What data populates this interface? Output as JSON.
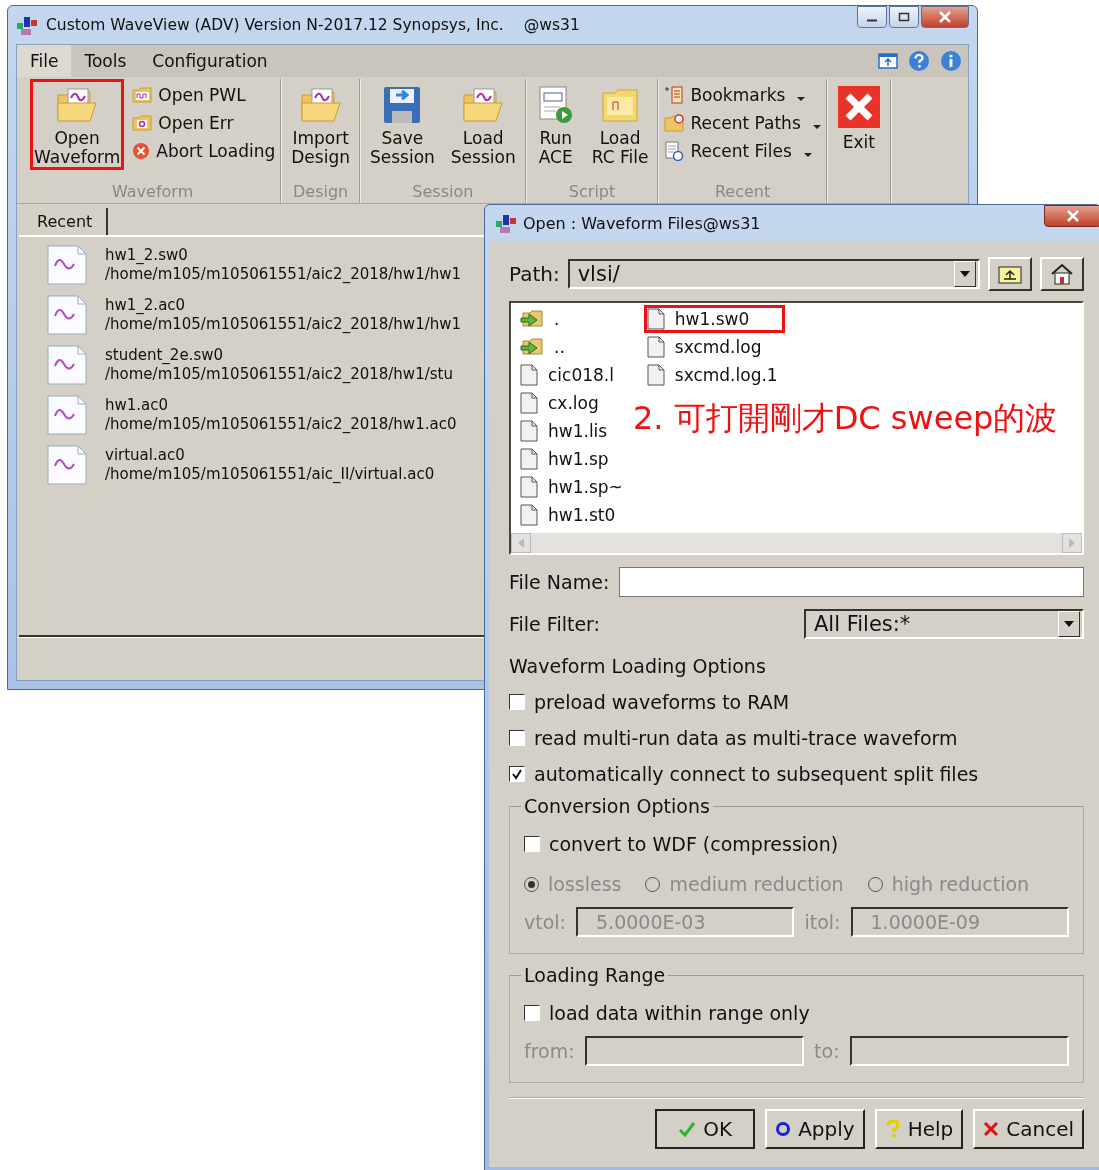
{
  "main_window": {
    "title": "Custom WaveView (ADV) Version N-2017.12 Synopsys, Inc.",
    "host": "@ws31"
  },
  "menu": [
    {
      "label": "File",
      "selected": true
    },
    {
      "label": "Tools",
      "selected": false
    },
    {
      "label": "Configuration",
      "selected": false
    }
  ],
  "ribbon": [
    {
      "label": "Waveform",
      "items": [
        {
          "kind": "large",
          "label": "Open\nWaveform",
          "highlighted": true
        },
        {
          "kind": "small",
          "label": "Open PWL"
        },
        {
          "kind": "small",
          "label": "Open Err"
        },
        {
          "kind": "small",
          "label": "Abort Loading"
        }
      ]
    },
    {
      "label": "Design",
      "items": [
        {
          "kind": "large",
          "label": "Import\nDesign"
        }
      ]
    },
    {
      "label": "Session",
      "items": [
        {
          "kind": "large",
          "label": "Save\nSession"
        },
        {
          "kind": "large",
          "label": "Load\nSession"
        }
      ]
    },
    {
      "label": "Script",
      "items": [
        {
          "kind": "large",
          "label": "Run\nACE"
        },
        {
          "kind": "large",
          "label": "Load\nRC File"
        }
      ]
    },
    {
      "label": "Recent",
      "items": [
        {
          "kind": "dropdown",
          "label": "Bookmarks"
        },
        {
          "kind": "dropdown",
          "label": "Recent Paths"
        },
        {
          "kind": "dropdown",
          "label": "Recent Files"
        }
      ]
    },
    {
      "items": [
        {
          "kind": "large",
          "label": "Exit"
        }
      ]
    }
  ],
  "tabs": [
    {
      "label": "Recent",
      "selected": true
    }
  ],
  "recent_files": [
    {
      "name": "hw1_2.sw0",
      "path": "/home/m105/m105061551/aic2_2018/hw1/hw1"
    },
    {
      "name": "hw1_2.ac0",
      "path": "/home/m105/m105061551/aic2_2018/hw1/hw1"
    },
    {
      "name": "student_2e.sw0",
      "path": "/home/m105/m105061551/aic2_2018/hw1/stu"
    },
    {
      "name": "hw1.ac0",
      "path": "/home/m105/m105061551/aic2_2018/hw1.ac0"
    },
    {
      "name": "virtual.ac0",
      "path": "/home/m105/m105061551/aic_II/virtual.ac0"
    }
  ],
  "dialog": {
    "title": "Open : Waveform Files@ws31",
    "path": {
      "label": "Path:",
      "value": "vlsi/"
    },
    "files": [
      {
        "name": ".",
        "kind": "folder",
        "highlighted": false
      },
      {
        "name": "..",
        "kind": "folder",
        "highlighted": false
      },
      {
        "name": "cic018.l",
        "kind": "file",
        "highlighted": false
      },
      {
        "name": "cx.log",
        "kind": "file",
        "highlighted": false
      },
      {
        "name": "hw1.lis",
        "kind": "file",
        "highlighted": false
      },
      {
        "name": "hw1.sp",
        "kind": "file",
        "highlighted": false
      },
      {
        "name": "hw1.sp~",
        "kind": "file",
        "highlighted": false
      },
      {
        "name": "hw1.st0",
        "kind": "file",
        "highlighted": false
      },
      {
        "name": "hw1.sw0",
        "kind": "file",
        "highlighted": true
      },
      {
        "name": "sxcmd.log",
        "kind": "file",
        "highlighted": false
      },
      {
        "name": "sxcmd.log.1",
        "kind": "file",
        "highlighted": false
      }
    ],
    "annotation": "2. 可打開剛才DC sweep的波",
    "file_name": {
      "label": "File Name:"
    },
    "file_filter": {
      "label": "File Filter:",
      "value": "All Files:*"
    },
    "loading_options": {
      "title": "Waveform Loading Options",
      "options": [
        {
          "label": "preload waveforms to RAM",
          "checked": false
        },
        {
          "label": "read multi-run data as multi-trace waveform",
          "checked": false
        },
        {
          "label": "automatically connect to subsequent split files",
          "checked": true
        }
      ]
    },
    "conversion": {
      "title": "Conversion Options",
      "convert": {
        "label": "convert to WDF (compression)",
        "checked": false
      },
      "disabled": true,
      "modes": [
        {
          "label": "lossless",
          "selected": true
        },
        {
          "label": "medium reduction",
          "selected": false
        },
        {
          "label": "high reduction",
          "selected": false
        }
      ],
      "vtol": {
        "label": "vtol:",
        "value": "5.0000E-03"
      },
      "itol": {
        "label": "itol:",
        "value": "1.0000E-09"
      }
    },
    "loading_range": {
      "title": "Loading Range",
      "option": {
        "label": "load data within range only",
        "checked": false
      },
      "disabled": true,
      "from": {
        "label": "from:"
      },
      "to": {
        "label": "to:"
      }
    },
    "buttons": [
      {
        "kind": "ok",
        "label": "OK"
      },
      {
        "kind": "apply",
        "label": "Apply"
      },
      {
        "kind": "help",
        "label": "Help"
      },
      {
        "kind": "cancel",
        "label": "Cancel"
      }
    ]
  }
}
